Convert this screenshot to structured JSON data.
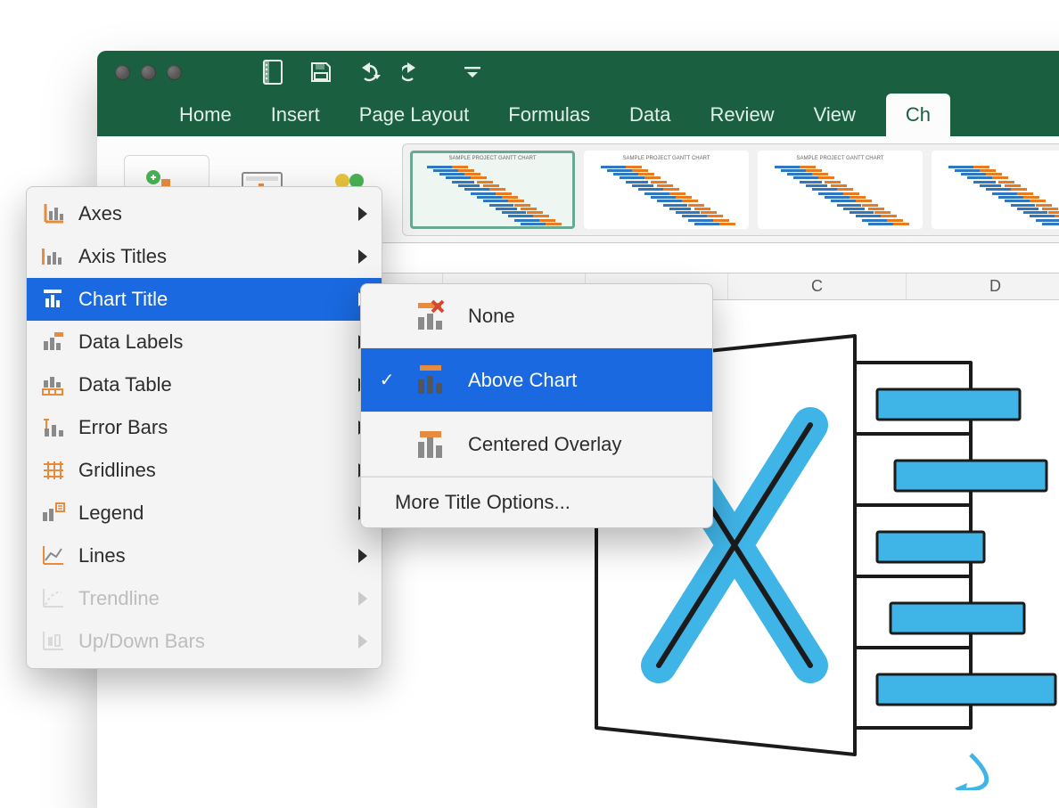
{
  "titlebar": {
    "qat": [
      "save-page",
      "save",
      "undo",
      "redo",
      "customize"
    ]
  },
  "tabs": {
    "items": [
      "Home",
      "Insert",
      "Page Layout",
      "Formulas",
      "Data",
      "Review",
      "View"
    ],
    "active_partial": "Ch"
  },
  "ribbon": {
    "add_chart_element": "Add Chart Element",
    "quick_layout": "Quick Layout",
    "change_colors": "Change Colors"
  },
  "columns": [
    "",
    "",
    "",
    "",
    "C",
    "D"
  ],
  "add_element_menu": {
    "items": [
      {
        "icon": "axes-icon",
        "label": "Axes"
      },
      {
        "icon": "axis-titles-icon",
        "label": "Axis Titles"
      },
      {
        "icon": "chart-title-icon",
        "label": "Chart Title",
        "highlight": true
      },
      {
        "icon": "data-labels-icon",
        "label": "Data Labels"
      },
      {
        "icon": "data-table-icon",
        "label": "Data Table"
      },
      {
        "icon": "error-bars-icon",
        "label": "Error Bars"
      },
      {
        "icon": "gridlines-icon",
        "label": "Gridlines"
      },
      {
        "icon": "legend-icon",
        "label": "Legend"
      },
      {
        "icon": "lines-icon",
        "label": "Lines"
      },
      {
        "icon": "trendline-icon",
        "label": "Trendline",
        "disabled": true
      },
      {
        "icon": "updown-bars-icon",
        "label": "Up/Down Bars",
        "disabled": true
      }
    ]
  },
  "chart_title_submenu": {
    "options": [
      {
        "label": "None",
        "checked": false
      },
      {
        "label": "Above Chart",
        "checked": true,
        "highlight": true
      },
      {
        "label": "Centered Overlay",
        "checked": false
      }
    ],
    "more": "More Title Options..."
  },
  "colors": {
    "green": "#1a6040",
    "blue": "#1a69e0",
    "orange": "#e67b22",
    "orange2": "#e88b3c",
    "steel": "#6a6a6a"
  }
}
